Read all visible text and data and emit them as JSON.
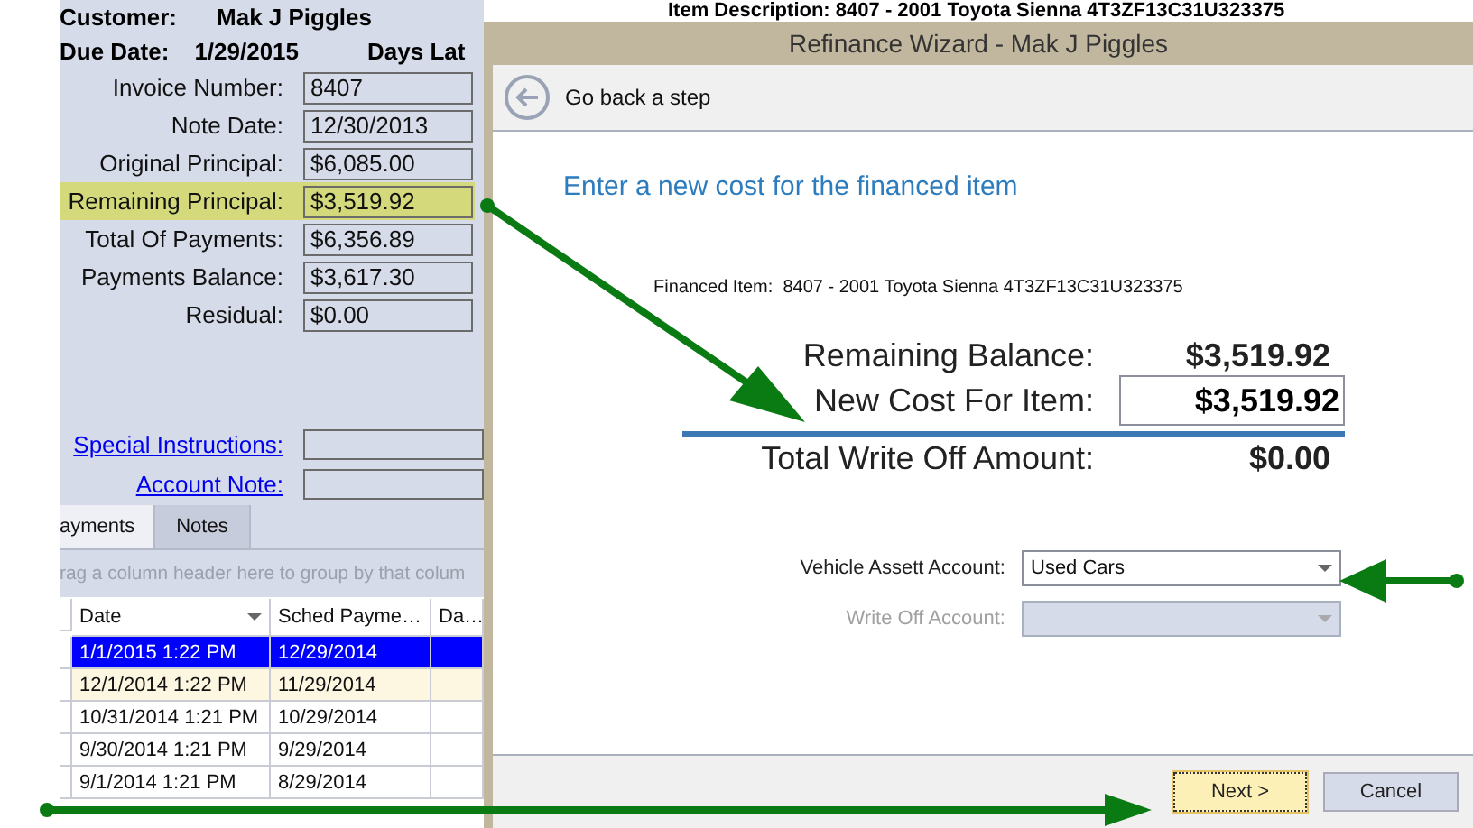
{
  "app": {
    "header": {
      "customer_label": "Customer:",
      "customer": "Mak J Piggles",
      "item_description_label": "Item Description:",
      "item_description": "8407 - 2001 Toyota Sienna 4T3ZF13C31U323375",
      "due_date_label": "Due Date:",
      "due_date": "1/29/2015",
      "days_late_label": "Days Lat"
    },
    "fields": [
      {
        "label": "Invoice Number:",
        "value": "8407",
        "highlighted": false
      },
      {
        "label": "Note Date:",
        "value": "12/30/2013",
        "highlighted": false
      },
      {
        "label": "Original Principal:",
        "value": "$6,085.00",
        "highlighted": false
      },
      {
        "label": "Remaining Principal:",
        "value": "$3,519.92",
        "highlighted": true
      },
      {
        "label": "Total Of Payments:",
        "value": "$6,356.89",
        "highlighted": false
      },
      {
        "label": "Payments Balance:",
        "value": "$3,617.30",
        "highlighted": false
      },
      {
        "label": "Residual:",
        "value": "$0.00",
        "highlighted": false
      }
    ],
    "links": [
      {
        "label": "Special Instructions:"
      },
      {
        "label": "Account Note:"
      }
    ],
    "tabs": [
      {
        "label": "ayments",
        "selected": true
      },
      {
        "label": "Notes",
        "selected": false
      }
    ],
    "group_panel_hint": "rag a column header here to group by that colum",
    "grid": {
      "columns": [
        {
          "label": "Date",
          "filter": true
        },
        {
          "label": "Sched Payme…",
          "filter": false
        },
        {
          "label": "Da…",
          "filter": false
        }
      ],
      "rows": [
        {
          "cells": [
            "1/1/2015 1:22 PM",
            "12/29/2014"
          ],
          "selected": true,
          "highlighted": false
        },
        {
          "cells": [
            "12/1/2014 1:22 PM",
            "11/29/2014"
          ],
          "selected": false,
          "highlighted": true
        },
        {
          "cells": [
            "10/31/2014 1:21 PM",
            "10/29/2014"
          ],
          "selected": false,
          "highlighted": false
        },
        {
          "cells": [
            "9/30/2014 1:21 PM",
            "9/29/2014"
          ],
          "selected": false,
          "highlighted": false
        },
        {
          "cells": [
            "9/1/2014 1:21 PM",
            "8/29/2014"
          ],
          "selected": false,
          "highlighted": false
        }
      ]
    }
  },
  "wizard": {
    "title": "Refinance Wizard - Mak J Piggles",
    "back_label": "Go back a step",
    "heading": "Enter a new cost for the financed item",
    "financed_item": {
      "label": "Financed Item:",
      "value": "8407 - 2001 Toyota Sienna 4T3ZF13C31U323375"
    },
    "summary": [
      {
        "kind": "text",
        "label": "Remaining Balance:",
        "value": "$3,519.92"
      },
      {
        "kind": "input",
        "label": "New Cost For Item:",
        "value": "$3,519.92"
      },
      {
        "kind": "total",
        "label": "Total Write Off Amount:",
        "value": "$0.00"
      }
    ],
    "accounts": [
      {
        "label": "Vehicle Assett Account:",
        "value": "Used Cars",
        "disabled": false
      },
      {
        "label": "Write Off Account:",
        "disabled": true
      }
    ],
    "buttons": [
      {
        "label": "Next >",
        "kind": "primary"
      },
      {
        "label": "Cancel",
        "kind": "default"
      }
    ]
  }
}
